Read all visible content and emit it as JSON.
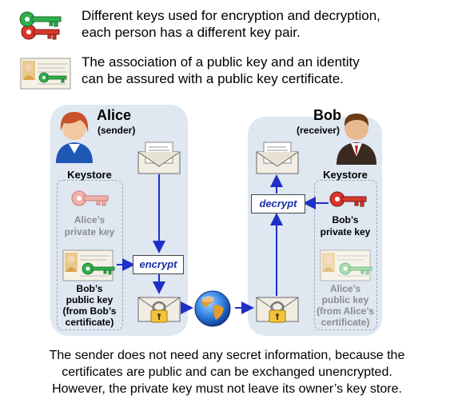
{
  "legend": {
    "line1": "Different keys used for encryption and decryption,",
    "line2": "each person has a different key pair.",
    "line3": "The association of a public key and an identity",
    "line4": "can be assured with a public key certificate."
  },
  "alice": {
    "name": "Alice",
    "role": "(sender)",
    "keystore": "Keystore",
    "private_key_1": "Alice’s",
    "private_key_2": "private key",
    "public_key_1": "Bob’s",
    "public_key_2": "public key",
    "public_key_3": "(from Bob’s",
    "public_key_4": "certificate)"
  },
  "bob": {
    "name": "Bob",
    "role": "(receiver)",
    "keystore": "Keystore",
    "private_key_1": "Bob’s",
    "private_key_2": "private key",
    "public_key_1": "Alice’s",
    "public_key_2": "public key",
    "public_key_3": "(from Alice’s",
    "public_key_4": "certificate)"
  },
  "ops": {
    "encrypt": "encrypt",
    "decrypt": "decrypt"
  },
  "footer": {
    "line1": "The sender does not need any secret information, because the",
    "line2": "certificates are public and can be exchanged unencrypted.",
    "line3": "However, the private key must not leave its owner’s key store."
  },
  "colors": {
    "panel": "#dfe7f1",
    "arrow": "#1f2fc8",
    "public_key": "#2fb04a",
    "private_key": "#d9362b",
    "op_text": "#1a2ea8"
  }
}
